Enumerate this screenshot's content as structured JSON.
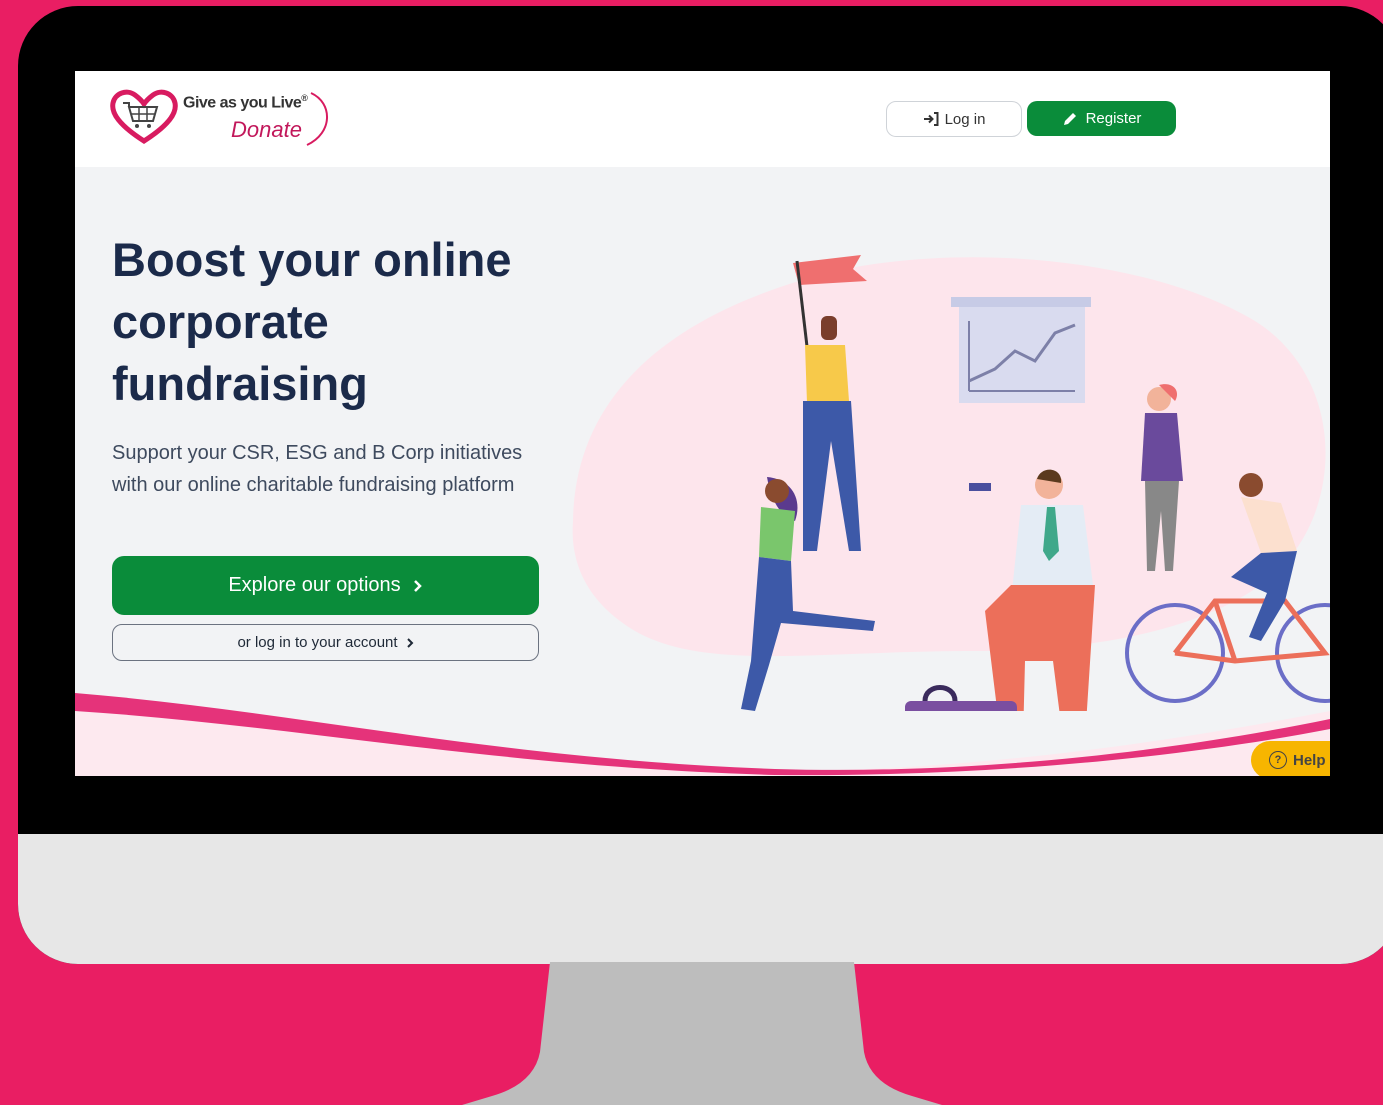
{
  "brand": {
    "name_line1": "Give as you Live",
    "registered_mark": "®",
    "name_line2": "Donate",
    "logo_icon": "heart-basket-icon",
    "logo_color": "#c2185b"
  },
  "nav": {
    "login_label": "Log in",
    "login_icon": "sign-in-icon",
    "register_label": "Register",
    "register_icon": "pencil-icon"
  },
  "hero": {
    "title": "Boost your online corporate fundraising",
    "subtitle": "Support your CSR, ESG and B Corp initiatives with our online charitable fundraising platform",
    "primary_cta": "Explore our options",
    "secondary_cta": "or log in to your account",
    "chevron_icon": "chevron-right-icon"
  },
  "help": {
    "label": "Help",
    "icon": "question-circle-icon"
  },
  "colors": {
    "page_background": "#e91e63",
    "brand_green": "#0a8c3a",
    "heading": "#1b2a4a",
    "hero_background": "#f2f3f5",
    "help_yellow": "#f7b500"
  }
}
